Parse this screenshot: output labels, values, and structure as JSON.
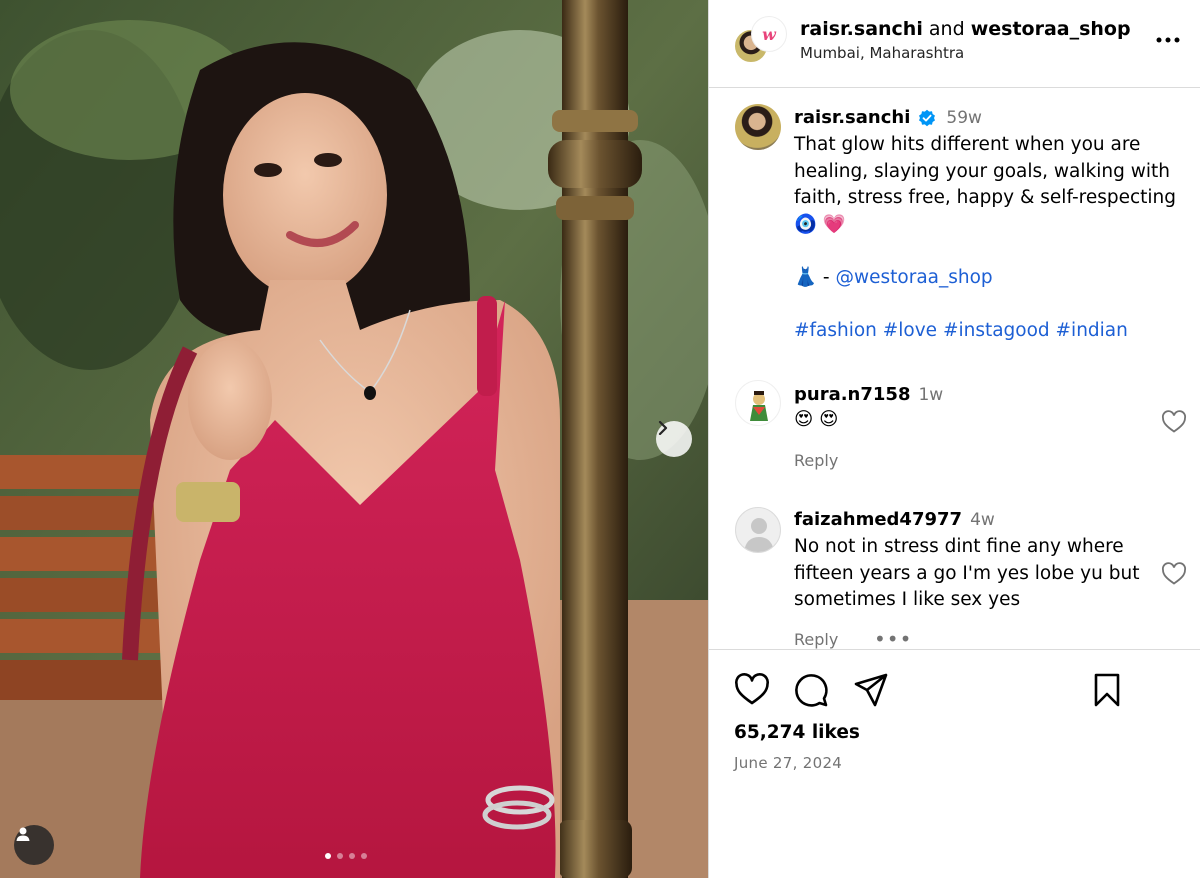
{
  "header": {
    "user1": "raisr.sanchi",
    "joiner": "and",
    "user2": "westoraa_shop",
    "location": "Mumbai, Maharashtra",
    "logo_text": "w"
  },
  "caption": {
    "username": "raisr.sanchi",
    "time": "59w",
    "text": "That glow hits different when you are healing, slaying your goals, walking with faith, stress free, happy & self-respecting 🧿 💗",
    "dress_emoji": "👗",
    "dash": " - ",
    "mention": "@westoraa_shop",
    "hashtags": "#fashion #love #instagood #indian"
  },
  "comments": [
    {
      "username": "pura.n7158",
      "time": "1w",
      "text": "😍 😍",
      "reply": "Reply"
    },
    {
      "username": "faizahmed47977",
      "time": "4w",
      "text": "No not in stress dint fine any where fifteen years a go I'm yes lobe yu but sometimes I like sex yes",
      "reply": "Reply",
      "more": "•••"
    }
  ],
  "footer": {
    "likes": "65,274 likes",
    "date": "June 27, 2024"
  },
  "carousel": {
    "slides": 4,
    "active_index": 0
  },
  "icons": [
    "more-icon",
    "verified-icon",
    "heart-icon",
    "comment-icon",
    "share-icon",
    "bookmark-icon",
    "chevron-right-icon",
    "user-tag-icon"
  ],
  "colors": {
    "link": "#1d5fd4",
    "verified": "#0095f6",
    "muted": "#737373",
    "border": "#dbdbdb"
  }
}
